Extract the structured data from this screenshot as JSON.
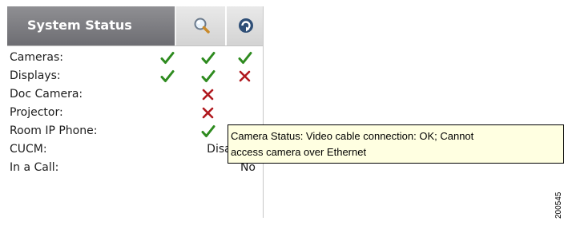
{
  "panel": {
    "title": "System Status",
    "search_button": "search-icon",
    "refresh_button": "refresh-icon"
  },
  "colors": {
    "check": "#2e8b1f",
    "cross": "#b0191f",
    "header_title_bg": "#7e7e82",
    "tooltip_bg": "#ffffe1"
  },
  "rows": [
    {
      "label": "Cameras:",
      "statuses": [
        "ok",
        "ok",
        "ok"
      ]
    },
    {
      "label": "Displays:",
      "statuses": [
        "ok",
        "ok",
        "error"
      ]
    },
    {
      "label": "Doc Camera:",
      "statuses": [
        "",
        "error",
        ""
      ]
    },
    {
      "label": "Projector:",
      "statuses": [
        "",
        "error",
        ""
      ]
    },
    {
      "label": "Room IP Phone:",
      "statuses": [
        "",
        "ok",
        ""
      ]
    },
    {
      "label": "CUCM:",
      "value": "Disabled"
    },
    {
      "label": "In a Call:",
      "value": "No"
    }
  ],
  "tooltip": {
    "line1": "Camera Status:  Video cable connection: OK;   Cannot",
    "line2": "access camera over Ethernet"
  },
  "figure_id": "200545"
}
